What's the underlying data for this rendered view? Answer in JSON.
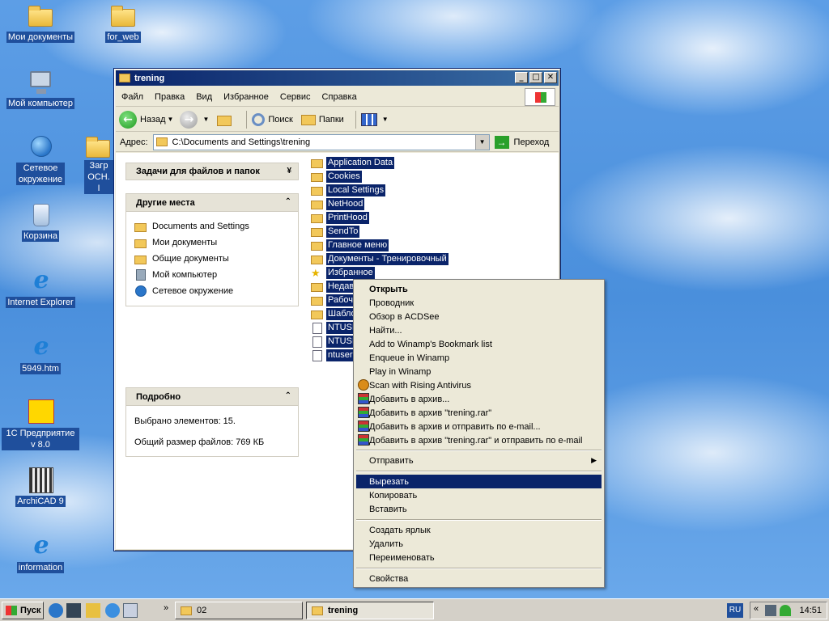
{
  "desktop": {
    "icons": [
      {
        "label": "Мои документы"
      },
      {
        "label": "for_web"
      },
      {
        "label": "Мой компьютер"
      },
      {
        "label": "Сетевое окружение"
      },
      {
        "label": "Загр ОСН. І"
      },
      {
        "label": "Корзина"
      },
      {
        "label": "Internet Explorer"
      },
      {
        "label": "5949.htm"
      },
      {
        "label": "1С Предприятие v 8.0"
      },
      {
        "label": "ArchiCAD 9"
      },
      {
        "label": "information"
      }
    ]
  },
  "window": {
    "title": "trening",
    "menu": [
      "Файл",
      "Правка",
      "Вид",
      "Избранное",
      "Сервис",
      "Справка"
    ],
    "toolbar": {
      "back": "Назад",
      "search": "Поиск",
      "folders": "Папки"
    },
    "address": {
      "label": "Адрес:",
      "value": "C:\\Documents and Settings\\trening",
      "go": "Переход"
    },
    "tasks": {
      "file_tasks_title": "Задачи для файлов и папок",
      "other_places_title": "Другие места",
      "other_places": [
        "Documents and Settings",
        "Мои документы",
        "Общие документы",
        "Мой компьютер",
        "Сетевое окружение"
      ],
      "details_title": "Подробно",
      "selected": "Выбрано элементов: 15.",
      "total_size": "Общий размер файлов: 769 КБ"
    },
    "files": [
      {
        "name": "Application Data",
        "icon": "folder"
      },
      {
        "name": "Cookies",
        "icon": "folder"
      },
      {
        "name": "Local Settings",
        "icon": "folder"
      },
      {
        "name": "NetHood",
        "icon": "folder"
      },
      {
        "name": "PrintHood",
        "icon": "folder"
      },
      {
        "name": "SendTo",
        "icon": "folder"
      },
      {
        "name": "Главное меню",
        "icon": "folder"
      },
      {
        "name": "Документы - Тренировочный",
        "icon": "folder"
      },
      {
        "name": "Избранное",
        "icon": "star"
      },
      {
        "name": "Недав",
        "icon": "folder"
      },
      {
        "name": "Рабоч",
        "icon": "folder"
      },
      {
        "name": "Шабло",
        "icon": "folder"
      },
      {
        "name": "NTUSER",
        "icon": "doc"
      },
      {
        "name": "NTUSER",
        "icon": "doc"
      },
      {
        "name": "ntuser.",
        "icon": "doc"
      }
    ]
  },
  "context_menu": {
    "items": [
      {
        "label": "Открыть",
        "bold": true
      },
      {
        "label": "Проводник"
      },
      {
        "label": "Обзор в ACDSee"
      },
      {
        "label": "Найти..."
      },
      {
        "label": "Add to Winamp's Bookmark list"
      },
      {
        "label": "Enqueue in Winamp"
      },
      {
        "label": "Play in Winamp"
      },
      {
        "label": "Scan with Rising Antivirus",
        "icon": "rising-icon"
      },
      {
        "label": "Добавить в архив...",
        "icon": "winrar-icon"
      },
      {
        "label": "Добавить в архив \"trening.rar\"",
        "icon": "winrar-icon"
      },
      {
        "label": "Добавить в архив и отправить по e-mail...",
        "icon": "winrar-icon"
      },
      {
        "label": "Добавить в архив \"trening.rar\" и отправить по e-mail",
        "icon": "winrar-icon"
      },
      {
        "label": "Отправить",
        "submenu": true
      },
      {
        "label": "Вырезать",
        "highlighted": true
      },
      {
        "label": "Копировать"
      },
      {
        "label": "Вставить"
      },
      {
        "label": "Создать ярлык"
      },
      {
        "label": "Удалить"
      },
      {
        "label": "Переименовать"
      },
      {
        "label": "Свойства"
      }
    ]
  },
  "taskbar": {
    "start": "Пуск",
    "tasks": [
      {
        "label": "02"
      },
      {
        "label": "trening",
        "active": true
      }
    ],
    "lang": "RU",
    "clock": "14:51"
  },
  "colors": {
    "selection": "#0a246a",
    "titlebar": "#0a246a",
    "face": "#ece9d8"
  }
}
